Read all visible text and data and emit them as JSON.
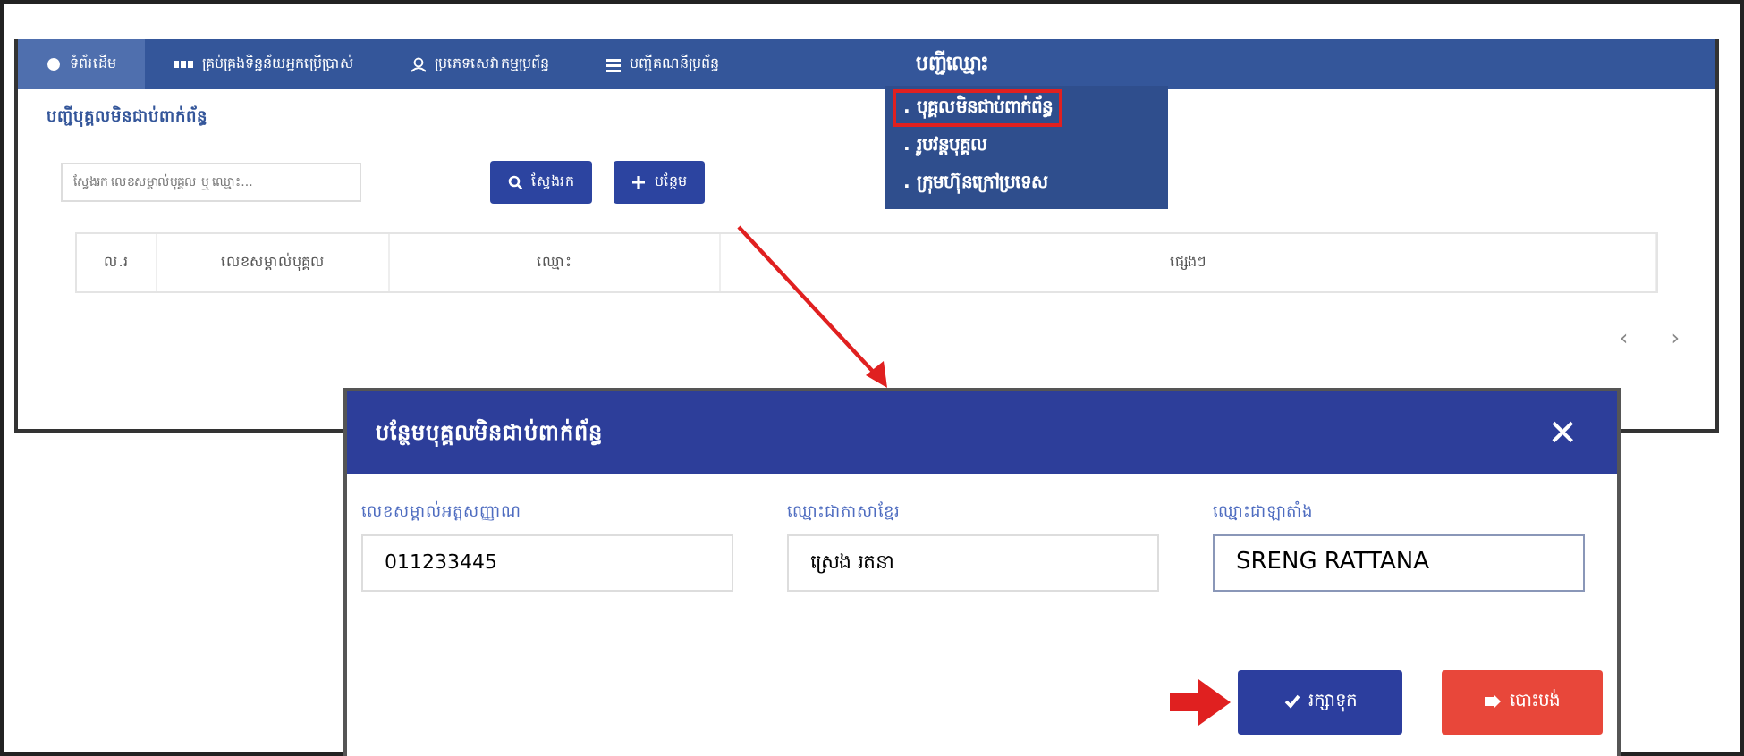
{
  "navbar": {
    "items": [
      {
        "label": "ទំព័រដើម",
        "selected": true
      },
      {
        "label": "គ្រប់គ្រងទិន្នន័យអ្នកប្រើប្រាស់",
        "selected": false
      },
      {
        "label": "ប្រភេទសេវាកម្មប្រព័ន្ធ",
        "selected": false
      },
      {
        "label": "បញ្ជីគណនីប្រព័ន្ធ",
        "selected": false
      }
    ],
    "menu": {
      "label": "បញ្ជីឈ្មោះ",
      "items": [
        {
          "label": ". បុគ្គលមិនជាប់ពាក់ព័ន្ធ",
          "highlighted": true
        },
        {
          "label": ". រូបវន្តបុគ្គល",
          "highlighted": false
        },
        {
          "label": ". ក្រុមហ៊ុនក្រៅប្រទេស",
          "highlighted": false
        }
      ]
    }
  },
  "panel": {
    "title": "បញ្ជីបុគ្គលមិនជាប់ពាក់ព័ន្ធ",
    "search": {
      "placeholder": "ស្វែងរក លេខសម្គាល់បុគ្គល ឬ ឈ្មោះ..."
    },
    "buttons": [
      {
        "label": "ស្វែងរក",
        "kind": "search"
      },
      {
        "label": "បន្ថែម",
        "kind": "add"
      }
    ],
    "table": {
      "columns": [
        "ល.រ",
        "លេខសម្គាល់បុគ្គល",
        "ឈ្មោះ",
        "ផ្សេងៗ"
      ]
    },
    "pagination": [
      "‹",
      "›"
    ]
  },
  "dialog": {
    "title": "បន្ថែមបុគ្គលមិនជាប់ពាក់ព័ន្ធ",
    "close": "✕",
    "fields": [
      {
        "label": "លេខសម្គាល់អត្តសញ្ញាណ",
        "value": "011233445",
        "focused": false
      },
      {
        "label": "ឈ្មោះជាភាសាខ្មែរ",
        "value": "ស្រេង រតនា",
        "focused": false
      },
      {
        "label": "ឈ្មោះជាឡាតាំង",
        "value": "SRENG RATTANA",
        "focused": true
      }
    ],
    "buttons": [
      {
        "label": "រក្សាទុក",
        "kind": "save"
      },
      {
        "label": "បោះបង់",
        "kind": "cancel"
      }
    ]
  }
}
